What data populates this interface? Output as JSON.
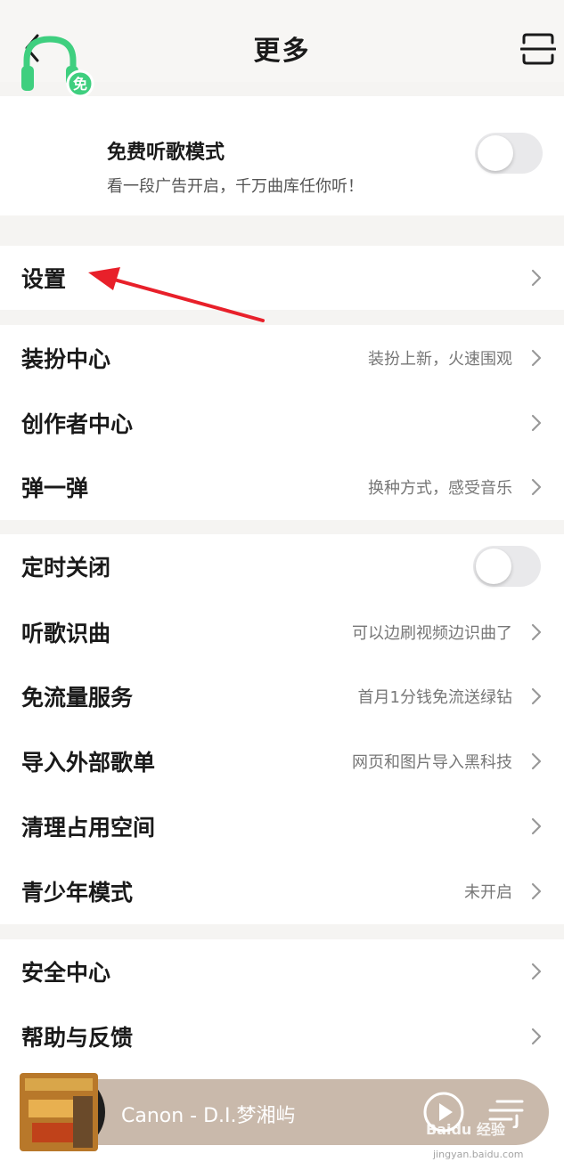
{
  "header": {
    "title": "更多"
  },
  "promo": {
    "title": "免费听歌模式",
    "subtitle": "看一段广告开启，千万曲库任你听！",
    "badge": "免",
    "enabled": false
  },
  "settings": {
    "label": "设置"
  },
  "group1": [
    {
      "label": "装扮中心",
      "hint": "装扮上新，火速围观"
    },
    {
      "label": "创作者中心",
      "hint": ""
    },
    {
      "label": "弹一弹",
      "hint": "换种方式，感受音乐"
    }
  ],
  "timer": {
    "label": "定时关闭",
    "enabled": false
  },
  "group2": [
    {
      "label": "听歌识曲",
      "hint": "可以边刷视频边识曲了"
    },
    {
      "label": "免流量服务",
      "hint": "首月1分钱免流送绿钻"
    },
    {
      "label": "导入外部歌单",
      "hint": "网页和图片导入黑科技"
    },
    {
      "label": "清理占用空间",
      "hint": ""
    },
    {
      "label": "青少年模式",
      "hint": "未开启"
    }
  ],
  "group3": [
    {
      "label": "安全中心",
      "hint": ""
    },
    {
      "label": "帮助与反馈",
      "hint": ""
    }
  ],
  "player": {
    "track": "Canon - D.I.梦湘屿"
  },
  "watermark": {
    "brand": "Baidu 经验",
    "url": "jingyan.baidu.com"
  },
  "colors": {
    "accent_green": "#3fcf7f",
    "annotation_red": "#e8202a",
    "player_bg": "#c9b9ab"
  }
}
